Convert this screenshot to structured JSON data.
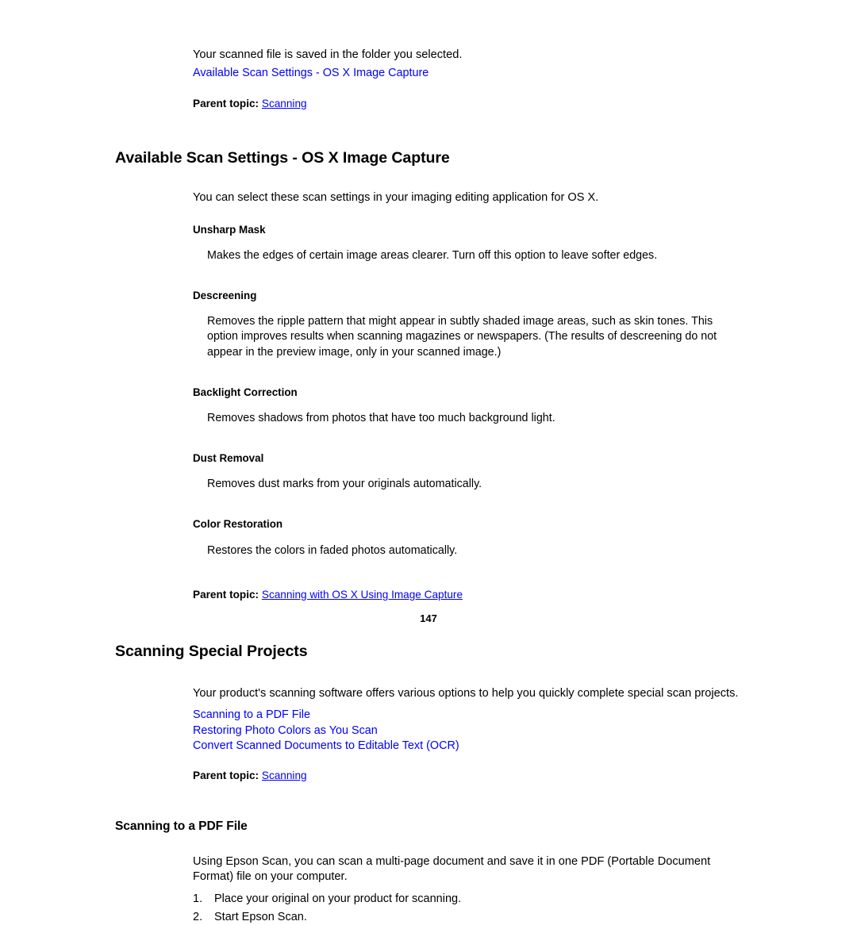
{
  "document": {
    "page_number": "147",
    "link_color": "#0000ff",
    "text_color": "#000000",
    "background_color": "#ffffff"
  },
  "intro": {
    "saved_note": "Your scanned file is saved in the folder you selected.",
    "related_link": "Available Scan Settings - OS X Image Capture",
    "parent_topic_label": "Parent topic:",
    "parent_topic_target": "Scanning"
  },
  "section_scan_settings": {
    "heading": "Available Scan Settings - OS X Image Capture",
    "intro": "You can select these scan settings in your imaging editing application for OS X.",
    "definitions": [
      {
        "term": "Unsharp Mask",
        "description": "Makes the edges of certain image areas clearer. Turn off this option to leave softer edges."
      },
      {
        "term": "Descreening",
        "description": "Removes the ripple pattern that might appear in subtly shaded image areas, such as skin tones. This option improves results when scanning magazines or newspapers. (The results of descreening do not appear in the preview image, only in your scanned image.)"
      },
      {
        "term": "Backlight Correction",
        "description": "Removes shadows from photos that have too much background light."
      },
      {
        "term": "Dust Removal",
        "description": "Removes dust marks from your originals automatically."
      },
      {
        "term": "Color Restoration",
        "description": "Restores the colors in faded photos automatically."
      }
    ],
    "parent_topic_label": "Parent topic:",
    "parent_topic_target": "Scanning with OS X Using Image Capture"
  },
  "section_special_projects": {
    "heading": "Scanning Special Projects",
    "intro": "Your product's scanning software offers various options to help you quickly complete special scan projects.",
    "links": [
      "Scanning to a PDF File",
      "Restoring Photo Colors as You Scan",
      "Convert Scanned Documents to Editable Text (OCR)"
    ],
    "parent_topic_label": "Parent topic:",
    "parent_topic_target": "Scanning"
  },
  "section_pdf": {
    "heading": "Scanning to a PDF File",
    "intro": "Using Epson Scan, you can scan a multi-page document and save it in one PDF (Portable Document Format) file on your computer.",
    "steps": [
      {
        "num": "1.",
        "text": "Place your original on your product for scanning."
      },
      {
        "num": "2.",
        "text": "Start Epson Scan."
      }
    ]
  }
}
